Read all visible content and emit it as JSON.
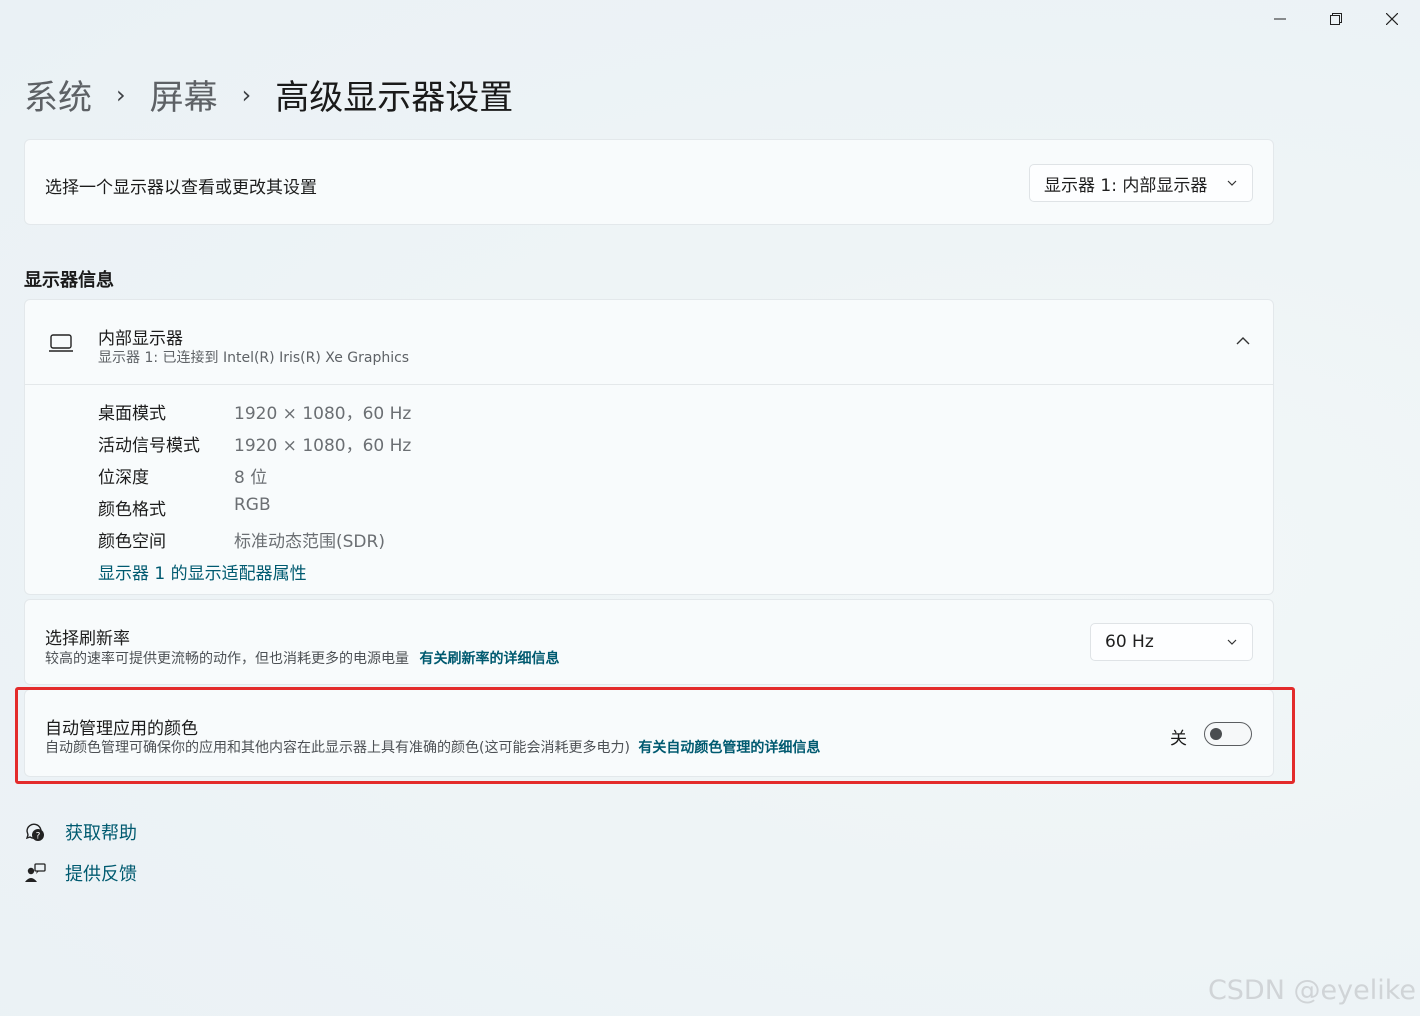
{
  "window_controls": {
    "minimize": "minimize-icon",
    "maximize": "restore-icon",
    "close": "close-icon"
  },
  "breadcrumb": {
    "items": [
      "系统",
      "屏幕"
    ],
    "current": "高级显示器设置",
    "separator": "›"
  },
  "display_selector": {
    "label": "选择一个显示器以查看或更改其设置",
    "selected": "显示器 1: 内部显示器"
  },
  "display_info": {
    "section_title": "显示器信息",
    "name": "内部显示器",
    "subtitle": "显示器 1: 已连接到 Intel(R) Iris(R) Xe Graphics",
    "rows": [
      {
        "label": "桌面模式",
        "value": "1920 × 1080，60 Hz"
      },
      {
        "label": "活动信号模式",
        "value": "1920 × 1080，60 Hz"
      },
      {
        "label": "位深度",
        "value": "8 位"
      },
      {
        "label": "颜色格式",
        "value": "RGB"
      },
      {
        "label": "颜色空间",
        "value": "标准动态范围(SDR)"
      }
    ],
    "adapter_link": "显示器 1 的显示适配器属性"
  },
  "refresh_rate": {
    "title": "选择刷新率",
    "description": "较高的速率可提供更流畅的动作，但也消耗更多的电源电量",
    "link": "有关刷新率的详细信息",
    "selected": "60 Hz"
  },
  "auto_color": {
    "title": "自动管理应用的颜色",
    "description": "自动颜色管理可确保你的应用和其他内容在此显示器上具有准确的颜色(这可能会消耗更多电力)",
    "link": "有关自动颜色管理的详细信息",
    "toggle_label": "关",
    "toggle_on": false
  },
  "footer": {
    "help": "获取帮助",
    "feedback": "提供反馈"
  },
  "watermark": "CSDN @eyelike",
  "colors": {
    "link": "#005a70",
    "highlight": "#e32b2b"
  }
}
